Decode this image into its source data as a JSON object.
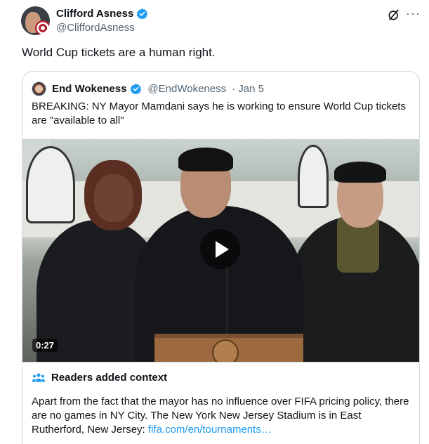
{
  "author": {
    "display_name": "Clifford Asness",
    "handle": "@CliffordAsness",
    "verified_icon": "verified-badge-icon"
  },
  "actions": {
    "grok_icon": "grok-icon",
    "more_icon": "more-icon",
    "more_label": "···"
  },
  "tweet": {
    "text": "World Cup tickets are a human right."
  },
  "quoted": {
    "display_name": "End Wokeness",
    "handle": "@EndWokeness",
    "date": "· Jan 5",
    "text": "BREAKING: NY Mayor Mamdani says he is working to ensure World Cup tickets are \"available to all\"",
    "video": {
      "duration": "0:27"
    }
  },
  "context": {
    "title": "Readers added context",
    "text": "Apart from the fact that the mayor has no influence over FIFA pricing policy, there are no games in NY City. The New York New Jersey Stadium is in East Rutherford, New Jersey: ",
    "link": "fifa.com/en/tournaments…"
  },
  "colors": {
    "accent": "#1d9bf0",
    "verified": "#1d9bf0",
    "text": "#0f1419",
    "muted": "#536471",
    "border": "#cfd9de"
  }
}
